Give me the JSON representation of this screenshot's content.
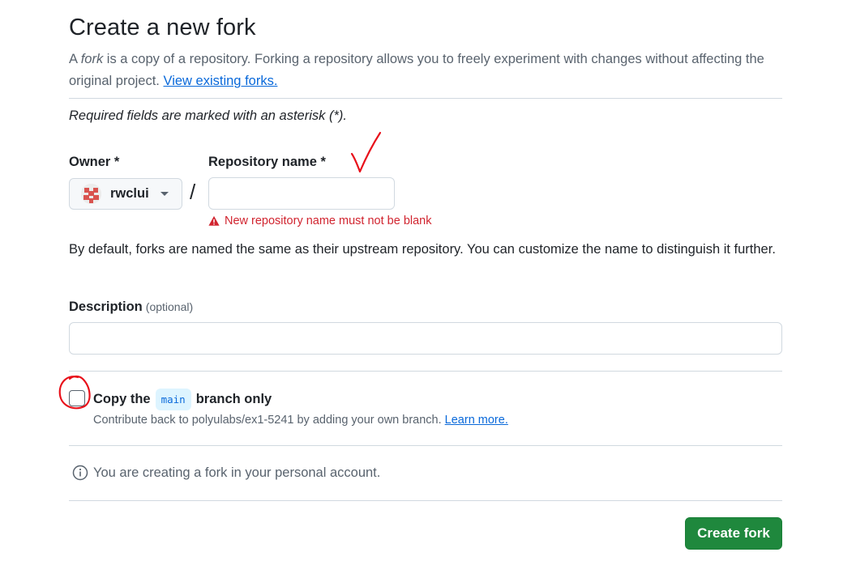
{
  "page": {
    "title": "Create a new fork",
    "intro_prefix": "A ",
    "intro_em": "fork",
    "intro_rest": " is a copy of a repository. Forking a repository allows you to freely experiment with changes without affecting the original project. ",
    "intro_link": "View existing forks.",
    "required_note": "Required fields are marked with an asterisk (*)."
  },
  "owner": {
    "label": "Owner *",
    "value": "rwclui",
    "icon": "avatar"
  },
  "separator": "/",
  "repository": {
    "label": "Repository name *",
    "value": "",
    "error": "New repository name must not be blank",
    "hint": "By default, forks are named the same as their upstream repository. You can customize the name to distinguish it further."
  },
  "description": {
    "label": "Description",
    "optional": "(optional)",
    "value": ""
  },
  "copy_branch": {
    "checked": false,
    "label_prefix": "Copy the",
    "branch": "main",
    "label_suffix": "branch only",
    "sub_text": "Contribute back to polyulabs/ex1-5241 by adding your own branch.",
    "sub_link": "Learn more."
  },
  "info": {
    "icon": "info-icon",
    "text": "You are creating a fork in your personal account."
  },
  "actions": {
    "create_label": "Create fork"
  },
  "colors": {
    "accent_link": "#0969da",
    "danger": "#d1242f",
    "primary_button": "#1f883d",
    "annotation": "#e8101a"
  }
}
